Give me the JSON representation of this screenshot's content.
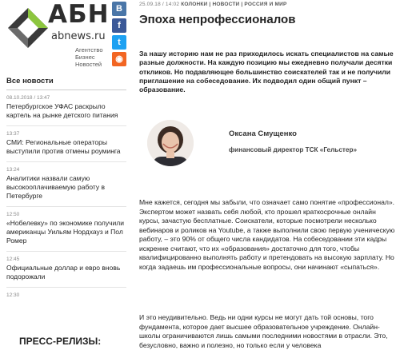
{
  "logo": {
    "big": "АБН",
    "site": "abnews.ru",
    "tagline_1": "Агентство",
    "tagline_2": "Бизнес",
    "tagline_3": "Новостей"
  },
  "social": [
    {
      "icon": "vk-icon",
      "glyph": "В"
    },
    {
      "icon": "facebook-icon",
      "glyph": "f"
    },
    {
      "icon": "twitter-icon",
      "glyph": "t"
    },
    {
      "icon": "rss-icon",
      "glyph": "◉"
    }
  ],
  "news": {
    "title": "Все новости",
    "items": [
      {
        "time": "08.10.2018 / 13:47",
        "text": "Петербургское УФАС раскрыло картель на рынке детского питания"
      },
      {
        "time": "13:37",
        "text": "СМИ: Региональные операторы выступили против отмены роуминга"
      },
      {
        "time": "13:24",
        "text": "Аналитики назвали самую высокооплачиваемую работу в Петербурге"
      },
      {
        "time": "12:50",
        "text": "«Нобелевку» по экономике получили американцы Уильям Нордхауз и Пол Ромер"
      },
      {
        "time": "12:45",
        "text": "Официальные доллар и евро вновь подорожали"
      },
      {
        "time": "12:30",
        "text": ""
      }
    ],
    "press_title": "ПРЕСС-РЕЛИЗЫ:"
  },
  "article": {
    "date": "25.09.18 / 14:02",
    "rubrics": "КОЛОНКИ | НОВОСТИ | РОССИЯ И МИР",
    "title": "Эпоха непрофессионалов",
    "lead": "За нашу историю нам не раз приходилось искать специалистов на самые разные должности. На каждую позицию мы ежедневно получали десятки откликов. Но подавляющее большинство соискателей так и не получили приглашение на собеседование. Их подводил один общий пункт – образование.",
    "author_name": "Оксана Смущенко",
    "author_role": "финансовый директор ТСК «Гельстер»",
    "body_1": "Мне кажется, сегодня мы забыли, что означает само понятие «профессионал». Экспертом может назвать себя любой, кто прошел краткосрочные онлайн курсы, зачастую бесплатные. Соискатели, которые посмотрели несколько вебинаров и роликов на Youtube, а также выполнили свою первую ученическую работу, – это 90% от общего числа кандидатов. На собеседовании эти кадры искренне считают, что их «образования» достаточно для того, чтобы квалифицированно выполнять работу и претендовать на высокую зарплату. Но когда задаешь им профессиональные вопросы, они начинают «сыпаться».",
    "body_2": "И это неудивительно. Ведь ни одни курсы не могут дать той основы, того фундамента, которое дает высшее образовательное учреждение. Онлайн-школы ограничиваются лишь самыми последними новостями в отрасли. Это, безусловно, важно и полезно, но только если у человека"
  }
}
